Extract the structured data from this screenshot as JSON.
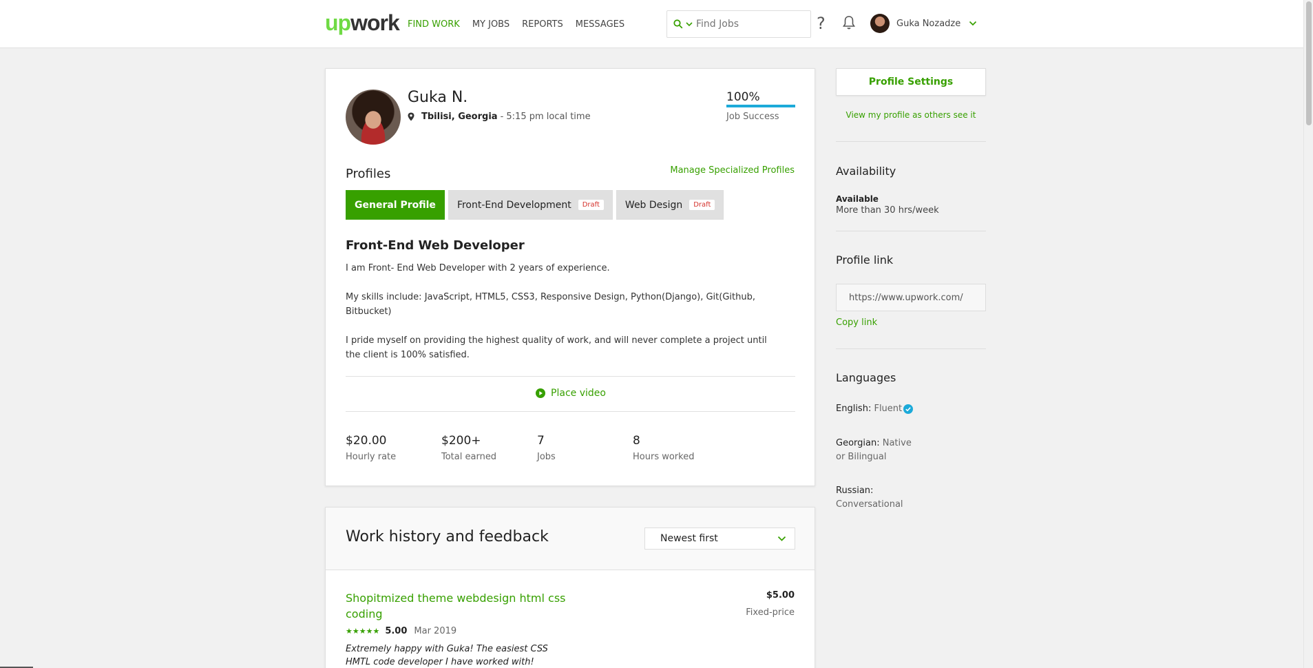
{
  "header": {
    "logo_up": "up",
    "logo_work": "work",
    "nav": [
      "FIND WORK",
      "MY JOBS",
      "REPORTS",
      "MESSAGES"
    ],
    "search_placeholder": "Find Jobs",
    "help": "?",
    "user_name": "Guka Nozadze"
  },
  "profile": {
    "name": "Guka N.",
    "city": "Tbilisi, Georgia",
    "local_time": "- 5:15 pm local time",
    "job_success_value": "100%",
    "job_success_label": "Job Success",
    "job_success_fraction": 1.0,
    "profiles_title": "Profiles",
    "manage_link": "Manage Specialized Profiles",
    "tabs": [
      {
        "label": "General Profile",
        "badge": ""
      },
      {
        "label": "Front-End Development",
        "badge": "Draft"
      },
      {
        "label": "Web Design",
        "badge": "Draft"
      }
    ],
    "headline": "Front-End Web Developer",
    "overview": [
      "I am Front- End Web Developer with 2 years of experience.",
      "My skills include: JavaScript, HTML5, CSS3, Responsive Design, Python(Django), Git(Github, Bitbucket)",
      "I pride myself on providing the highest quality of work, and will never complete a project until the client is 100% satisfied."
    ],
    "place_video": "Place video",
    "stats": [
      {
        "value": "$20.00",
        "label": "Hourly rate"
      },
      {
        "value": "$200+",
        "label": "Total earned"
      },
      {
        "value": "7",
        "label": "Jobs"
      },
      {
        "value": "8",
        "label": "Hours worked"
      }
    ]
  },
  "history": {
    "title": "Work history and feedback",
    "sort": "Newest first",
    "job": {
      "title": "Shopitmized theme webdesign html css coding",
      "amount": "$5.00",
      "type": "Fixed-price",
      "stars": "★★★★★",
      "rating": 5.0,
      "score": "5.00",
      "date": "Mar 2019",
      "feedback": "Extremely happy with Guka! The easiest CSS HMTL code developer I have worked with!"
    }
  },
  "sidebar": {
    "settings_button": "Profile Settings",
    "view_link": "View my profile as others see it",
    "availability_title": "Availability",
    "availability_label": "Available",
    "availability_value": "More than 30 hrs/week",
    "profile_link_title": "Profile link",
    "profile_link_value": "https://www.upwork.com/",
    "copy_link": "Copy link",
    "languages_title": "Languages",
    "languages": [
      {
        "name": "English:",
        "level": "Fluent"
      },
      {
        "name": "Georgian:",
        "level": "Native or Bilingual"
      },
      {
        "name": "Russian:",
        "level": "Conversational"
      }
    ]
  },
  "colors": {
    "brand_green": "#37a000",
    "logo_green": "#6fda44",
    "job_success_blue": "#1caad9",
    "draft_red": "#d4312b"
  },
  "icons": [
    "search-icon",
    "chevron-down-icon",
    "help-icon",
    "bell-icon",
    "location-pin-icon",
    "play-icon",
    "star-icon",
    "verified-icon"
  ]
}
